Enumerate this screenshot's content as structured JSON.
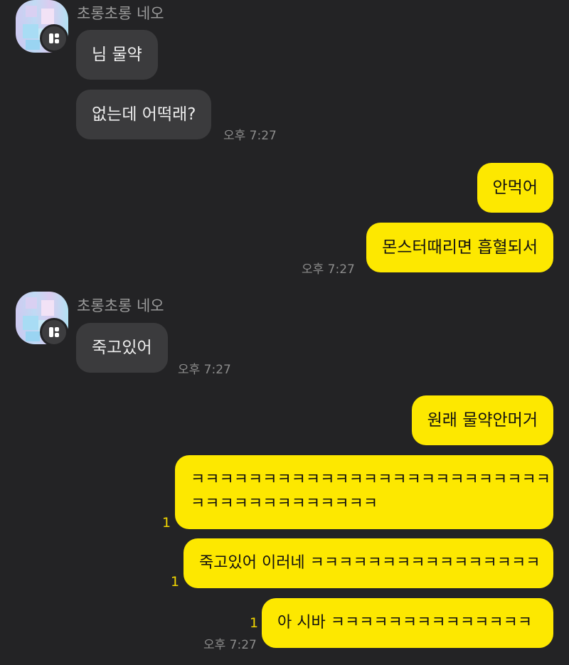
{
  "chat": {
    "sender_name": "초롱초롱 네오",
    "messages": [
      {
        "dir": "in",
        "text": "님 물약"
      },
      {
        "dir": "in",
        "text": "없는데 어떡래?",
        "time": "오후 7:27"
      },
      {
        "dir": "out",
        "text": "안먹어"
      },
      {
        "dir": "out",
        "text": "몬스터때리면 흡혈되서",
        "time": "오후 7:27"
      },
      {
        "dir": "in",
        "text": "죽고있어",
        "time": "오후 7:27"
      },
      {
        "dir": "out",
        "text": "원래 물약안머거"
      },
      {
        "dir": "out",
        "line1": "ㅋㅋㅋㅋㅋㅋㅋㅋㅋㅋㅋㅋㅋㅋㅋㅋㅋㅋㅋㅋㅋㅋㅋㅋㅋ",
        "line2": "ㅋㅋㅋㅋㅋㅋㅋㅋㅋㅋㅋㅋㅋ",
        "unread": "1"
      },
      {
        "dir": "out",
        "text": "죽고있어 이러네 ㅋㅋㅋㅋㅋㅋㅋㅋㅋㅋㅋㅋㅋㅋㅋㅋ",
        "unread": "1"
      },
      {
        "dir": "out",
        "text": "아 시바 ㅋㅋㅋㅋㅋㅋㅋㅋㅋㅋㅋㅋㅋㅋ",
        "unread": "1",
        "time": "오후 7:27"
      }
    ]
  },
  "icons": {
    "avatar_badge": "board-icon"
  },
  "colors": {
    "background": "#232325",
    "incoming_bubble": "#3b3b3d",
    "outgoing_bubble": "#fde800",
    "unread": "#f2d600"
  }
}
